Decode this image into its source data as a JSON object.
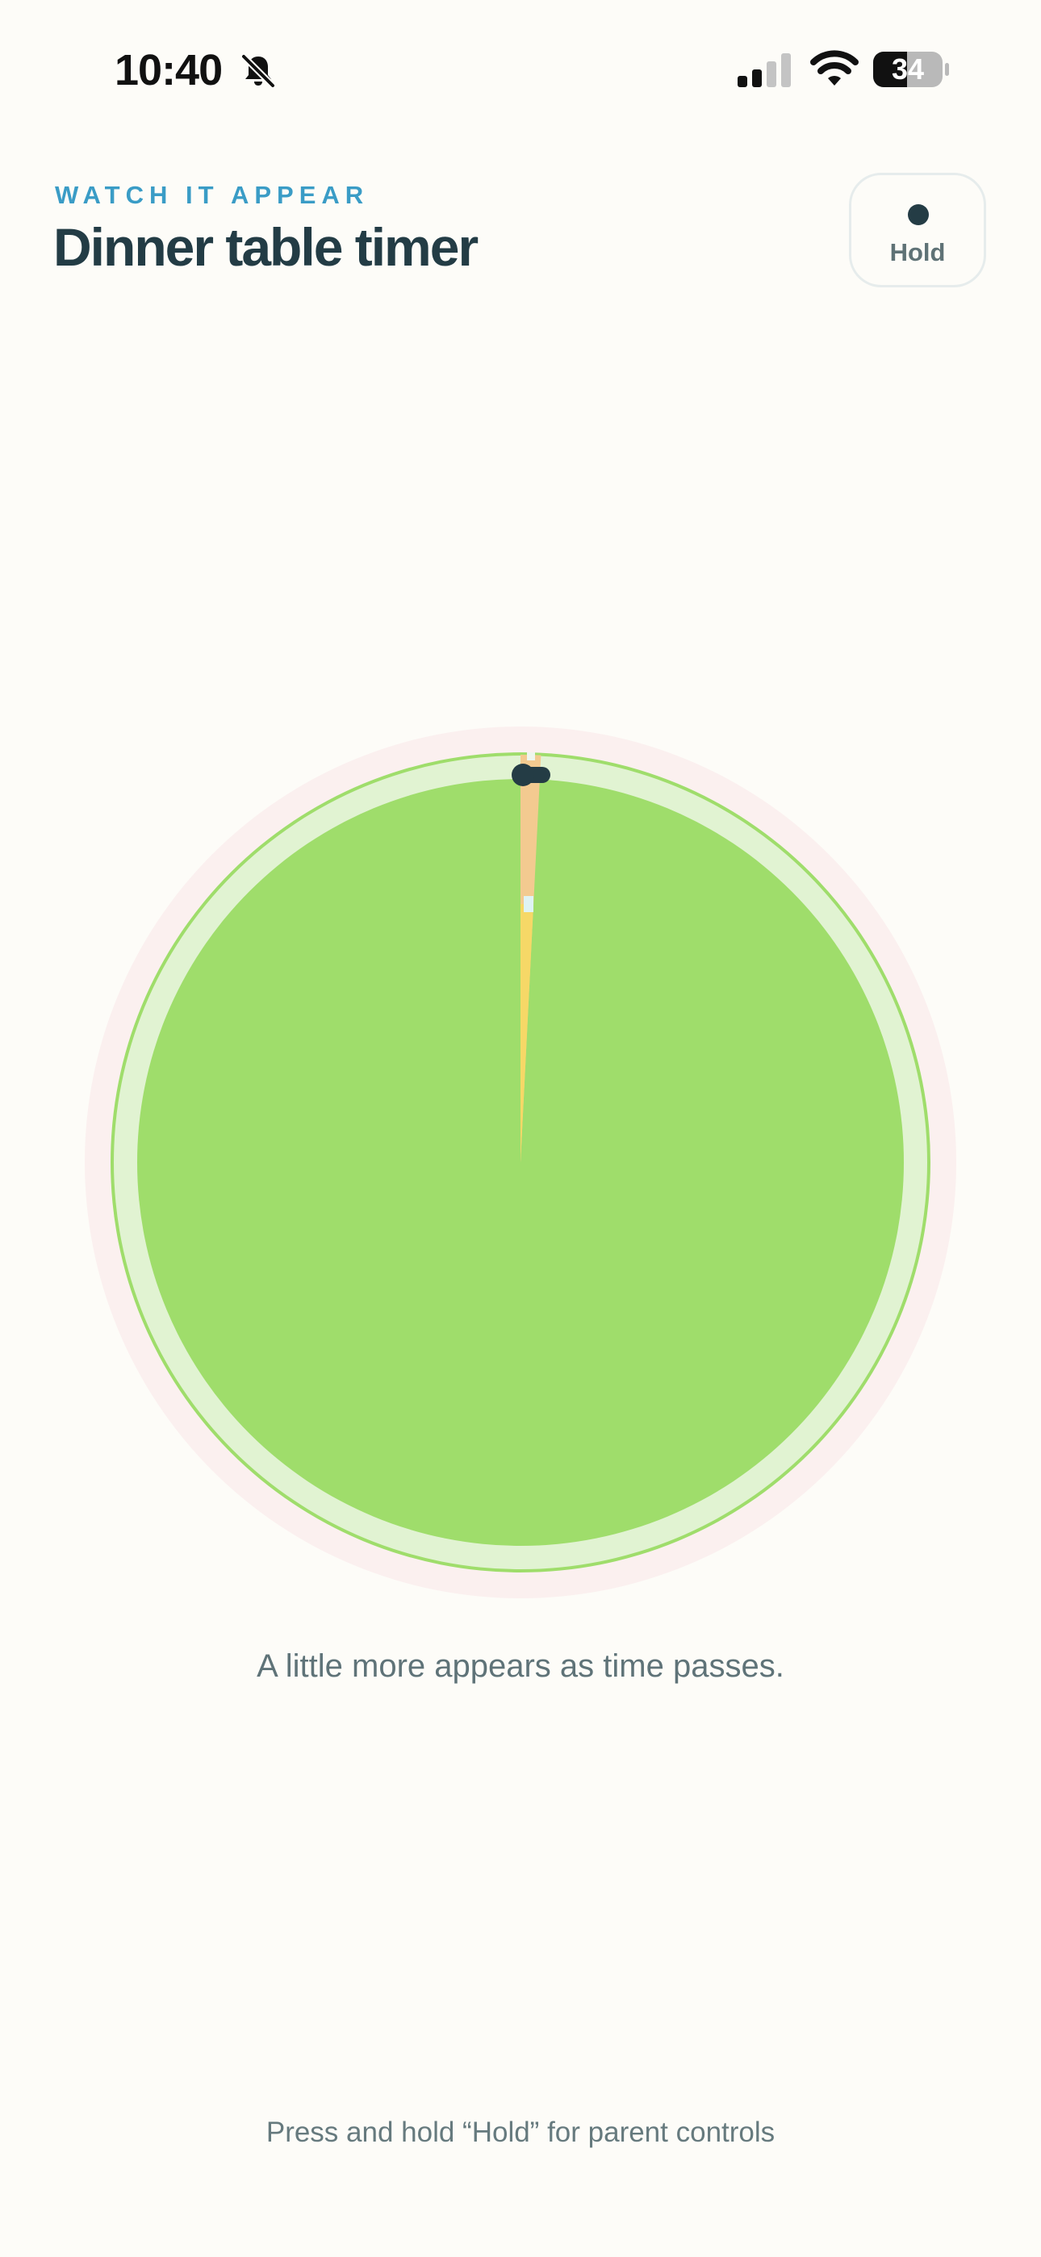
{
  "status_bar": {
    "time": "10:40",
    "battery_level": "34",
    "icons": [
      "bell-slash-icon",
      "cellular-signal-icon",
      "wifi-icon",
      "battery-icon"
    ]
  },
  "header": {
    "eyebrow": "WATCH IT APPEAR",
    "title": "Dinner table timer",
    "hold_button_label": "Hold"
  },
  "timer": {
    "elapsed_fraction": 0.008,
    "colors": {
      "remaining": "#9fdd6b",
      "inner_ring": "#e1f3d2",
      "outer_halo": "#fbf0ef",
      "elapsed_wedge": "#f3ca90",
      "elapsed_tip": "#f6d867",
      "hand": "#243c45"
    }
  },
  "caption": "A little more appears as time passes.",
  "footer_hint": "Press and hold “Hold” for parent controls"
}
